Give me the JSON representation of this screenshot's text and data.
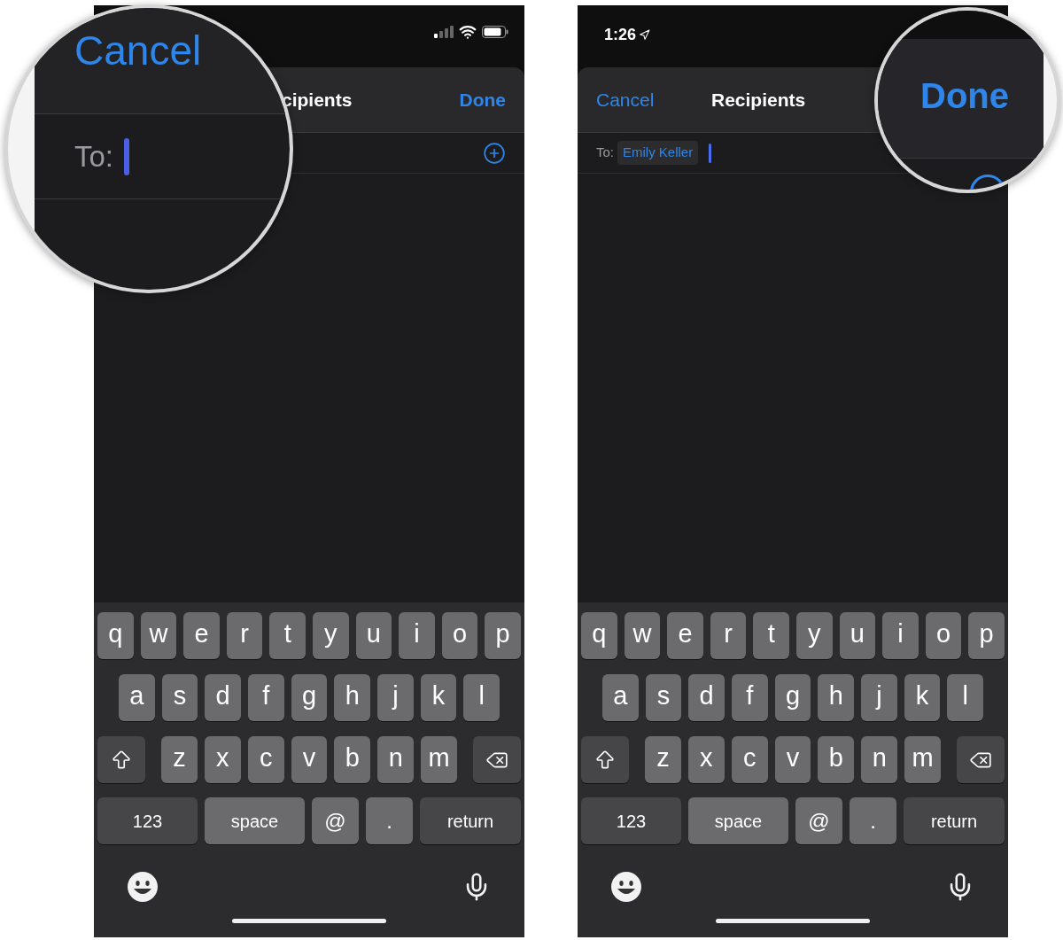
{
  "phones": [
    {
      "nav": {
        "title": "cipients",
        "done": "Done"
      },
      "magnifier": {
        "cancel": "Cancel",
        "to_label": "To:"
      },
      "keyboard": {
        "rows": [
          {
            "keys": [
              {
                "kind": "char",
                "label": "q"
              },
              {
                "kind": "char",
                "label": "w"
              },
              {
                "kind": "char",
                "label": "e"
              },
              {
                "kind": "char",
                "label": "r"
              },
              {
                "kind": "char",
                "label": "t"
              },
              {
                "kind": "char",
                "label": "y"
              },
              {
                "kind": "char",
                "label": "u"
              },
              {
                "kind": "char",
                "label": "i"
              },
              {
                "kind": "char",
                "label": "o"
              },
              {
                "kind": "char",
                "label": "p"
              }
            ]
          },
          {
            "keys": [
              {
                "kind": "char",
                "label": "a"
              },
              {
                "kind": "char",
                "label": "s"
              },
              {
                "kind": "char",
                "label": "d"
              },
              {
                "kind": "char",
                "label": "f"
              },
              {
                "kind": "char",
                "label": "g"
              },
              {
                "kind": "char",
                "label": "h"
              },
              {
                "kind": "char",
                "label": "j"
              },
              {
                "kind": "char",
                "label": "k"
              },
              {
                "kind": "char",
                "label": "l"
              }
            ]
          },
          {
            "keys": [
              {
                "kind": "shift"
              },
              {
                "kind": "char",
                "label": "z"
              },
              {
                "kind": "char",
                "label": "x"
              },
              {
                "kind": "char",
                "label": "c"
              },
              {
                "kind": "char",
                "label": "v"
              },
              {
                "kind": "char",
                "label": "b"
              },
              {
                "kind": "char",
                "label": "n"
              },
              {
                "kind": "char",
                "label": "m"
              },
              {
                "kind": "backspace"
              }
            ]
          },
          {
            "keys": [
              {
                "kind": "mode",
                "label": "123"
              },
              {
                "kind": "space",
                "label": "space"
              },
              {
                "kind": "symbol",
                "label": "@"
              },
              {
                "kind": "symbol",
                "label": "."
              },
              {
                "kind": "return",
                "label": "return"
              }
            ]
          }
        ]
      }
    },
    {
      "status_bar": {
        "time": "1:26"
      },
      "nav": {
        "cancel": "Cancel",
        "title": "Recipients"
      },
      "to_row": {
        "label": "To:",
        "recipients": [
          {
            "name": "Emily Keller"
          }
        ]
      },
      "magnifier": {
        "done": "Done"
      },
      "keyboard": {
        "rows": [
          {
            "keys": [
              {
                "kind": "char",
                "label": "q"
              },
              {
                "kind": "char",
                "label": "w"
              },
              {
                "kind": "char",
                "label": "e"
              },
              {
                "kind": "char",
                "label": "r"
              },
              {
                "kind": "char",
                "label": "t"
              },
              {
                "kind": "char",
                "label": "y"
              },
              {
                "kind": "char",
                "label": "u"
              },
              {
                "kind": "char",
                "label": "i"
              },
              {
                "kind": "char",
                "label": "o"
              },
              {
                "kind": "char",
                "label": "p"
              }
            ]
          },
          {
            "keys": [
              {
                "kind": "char",
                "label": "a"
              },
              {
                "kind": "char",
                "label": "s"
              },
              {
                "kind": "char",
                "label": "d"
              },
              {
                "kind": "char",
                "label": "f"
              },
              {
                "kind": "char",
                "label": "g"
              },
              {
                "kind": "char",
                "label": "h"
              },
              {
                "kind": "char",
                "label": "j"
              },
              {
                "kind": "char",
                "label": "k"
              },
              {
                "kind": "char",
                "label": "l"
              }
            ]
          },
          {
            "keys": [
              {
                "kind": "shift"
              },
              {
                "kind": "char",
                "label": "z"
              },
              {
                "kind": "char",
                "label": "x"
              },
              {
                "kind": "char",
                "label": "c"
              },
              {
                "kind": "char",
                "label": "v"
              },
              {
                "kind": "char",
                "label": "b"
              },
              {
                "kind": "char",
                "label": "n"
              },
              {
                "kind": "char",
                "label": "m"
              },
              {
                "kind": "backspace"
              }
            ]
          },
          {
            "keys": [
              {
                "kind": "mode",
                "label": "123"
              },
              {
                "kind": "space",
                "label": "space"
              },
              {
                "kind": "symbol",
                "label": "@"
              },
              {
                "kind": "symbol",
                "label": "."
              },
              {
                "kind": "return",
                "label": "return"
              }
            ]
          }
        ]
      }
    }
  ]
}
